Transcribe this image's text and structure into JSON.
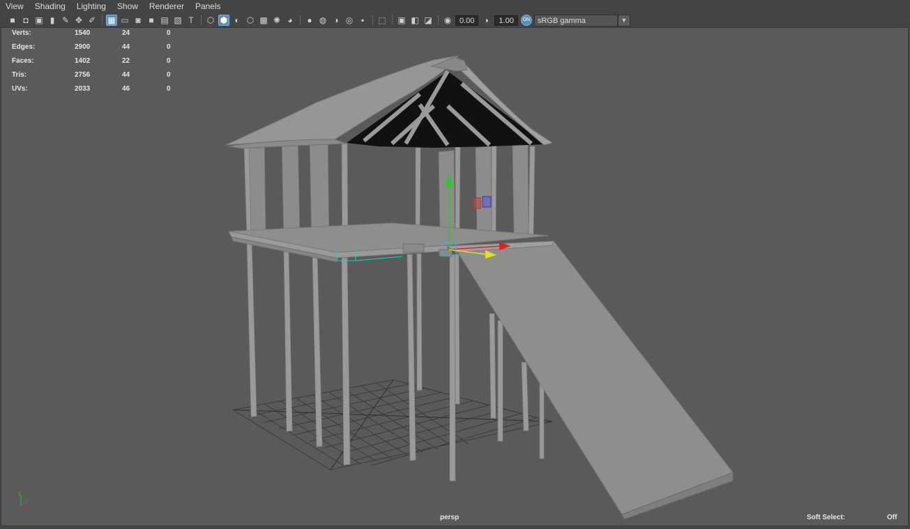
{
  "menu": [
    "View",
    "Shading",
    "Lighting",
    "Show",
    "Renderer",
    "Panels"
  ],
  "toolbar": {
    "exposure_value": "0.00",
    "gamma_value": "1.00",
    "color_space": "sRGB gamma",
    "color_space_dropdown_icon": "chevron-down-icon"
  },
  "hud": {
    "rows": [
      {
        "label": "Verts:",
        "v1": "1540",
        "v2": "24",
        "v3": "0"
      },
      {
        "label": "Edges:",
        "v1": "2900",
        "v2": "44",
        "v3": "0"
      },
      {
        "label": "Faces:",
        "v1": "1402",
        "v2": "22",
        "v3": "0"
      },
      {
        "label": "Tris:",
        "v1": "2756",
        "v2": "44",
        "v3": "0"
      },
      {
        "label": "UVs:",
        "v1": "2033",
        "v2": "46",
        "v3": "0"
      }
    ]
  },
  "viewport": {
    "camera": "persp",
    "soft_select_label": "Soft Select:",
    "soft_select_value": "Off",
    "axis": {
      "y": "y",
      "z": "z"
    }
  },
  "colors": {
    "background": "#5a5a5a",
    "mesh": "#8f8f8f",
    "gizmo_x": "#e02020",
    "gizmo_y": "#20d020",
    "gizmo_z": "#3030d0",
    "highlight": "#00e0c0"
  }
}
